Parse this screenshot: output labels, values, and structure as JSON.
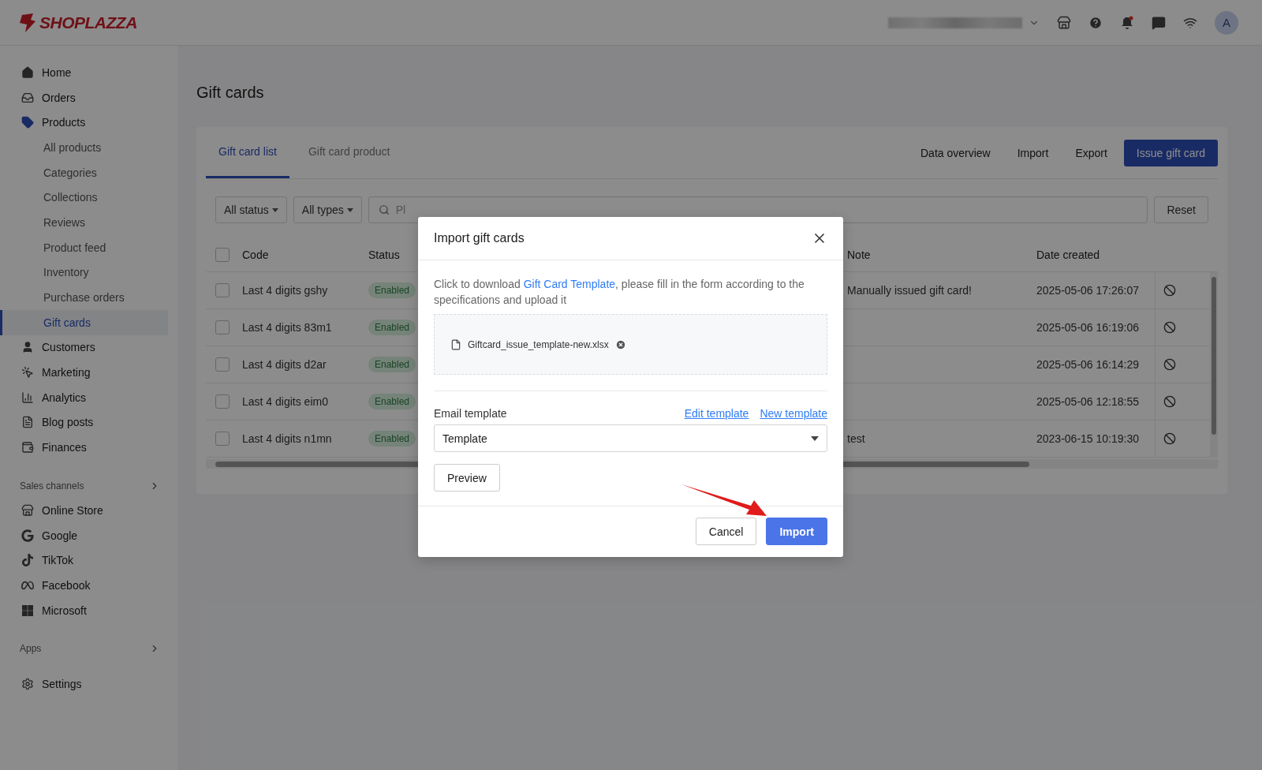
{
  "topbar": {
    "logo": "SHOPLAZZA",
    "avatar": "A"
  },
  "sidebar": {
    "main": [
      {
        "kind": "home",
        "label": "Home",
        "selected": false
      },
      {
        "kind": "orders",
        "label": "Orders",
        "selected": false
      },
      {
        "kind": "products",
        "label": "Products",
        "selected": false,
        "expanded": true,
        "children": [
          {
            "label": "All products",
            "selected": false
          },
          {
            "label": "Categories",
            "selected": false
          },
          {
            "label": "Collections",
            "selected": false
          },
          {
            "label": "Reviews",
            "selected": false
          },
          {
            "label": "Product feed",
            "selected": false
          },
          {
            "label": "Inventory",
            "selected": false
          },
          {
            "label": "Purchase orders",
            "selected": false
          },
          {
            "label": "Gift cards",
            "selected": true
          }
        ]
      },
      {
        "kind": "customers",
        "label": "Customers",
        "selected": false
      },
      {
        "kind": "marketing",
        "label": "Marketing",
        "selected": false
      },
      {
        "kind": "analytics",
        "label": "Analytics",
        "selected": false
      },
      {
        "kind": "blog",
        "label": "Blog posts",
        "selected": false
      },
      {
        "kind": "finances",
        "label": "Finances",
        "selected": false
      }
    ],
    "channels_heading": "Sales channels",
    "channels": [
      {
        "kind": "store",
        "label": "Online Store",
        "selected": false
      },
      {
        "kind": "google",
        "label": "Google",
        "selected": false
      },
      {
        "kind": "tiktok",
        "label": "TikTok",
        "selected": false
      },
      {
        "kind": "meta",
        "label": "Facebook",
        "selected": false
      },
      {
        "kind": "microsoft",
        "label": "Microsoft",
        "selected": false
      }
    ],
    "apps_heading": "Apps",
    "footer": [
      {
        "kind": "settings",
        "label": "Settings",
        "selected": false
      }
    ]
  },
  "page": {
    "title": "Gift cards",
    "tabs": [
      {
        "label": "Gift card list",
        "selected": true
      },
      {
        "label": "Gift card product",
        "selected": false
      }
    ],
    "actions": [
      "Data overview",
      "Import",
      "Export"
    ],
    "primary_action": "Issue gift card",
    "filters": [
      "All status",
      "All types"
    ],
    "search": {
      "placeholder": "Pl"
    },
    "reset": "Reset",
    "table": {
      "select_all_checked": false,
      "columns": [
        "Code",
        "Status",
        "Note",
        "Date created"
      ],
      "rows": [
        {
          "checked": false,
          "code": "Last 4 digits gshy",
          "status": "Enabled",
          "note": "Manually issued gift card!",
          "date": "2025-05-06 17:26:07"
        },
        {
          "checked": false,
          "code": "Last 4 digits 83m1",
          "status": "Enabled",
          "note": "",
          "date": "2025-05-06 16:19:06"
        },
        {
          "checked": false,
          "code": "Last 4 digits d2ar",
          "status": "Enabled",
          "note": "",
          "date": "2025-05-06 16:14:29"
        },
        {
          "checked": false,
          "code": "Last 4 digits eim0",
          "status": "Enabled",
          "note": "",
          "date": "2025-05-06 12:18:55"
        },
        {
          "checked": false,
          "code": "Last 4 digits n1mn",
          "status": "Enabled",
          "note": "test",
          "date": "2023-06-15 10:19:30"
        }
      ]
    }
  },
  "modal": {
    "title": "Import gift cards",
    "text_before": "Click to download ",
    "link": "Gift Card Template",
    "text_after": ", please fill in the form according to the specifications and upload it",
    "file": "Giftcard_issue_template-new.xlsx",
    "email_label": "Email template",
    "links": [
      "Edit template",
      "New template"
    ],
    "select_value": "Template",
    "preview": "Preview",
    "buttons": [
      {
        "label": "Cancel",
        "kind": "secondary"
      },
      {
        "label": "Import",
        "kind": "primary"
      }
    ]
  }
}
